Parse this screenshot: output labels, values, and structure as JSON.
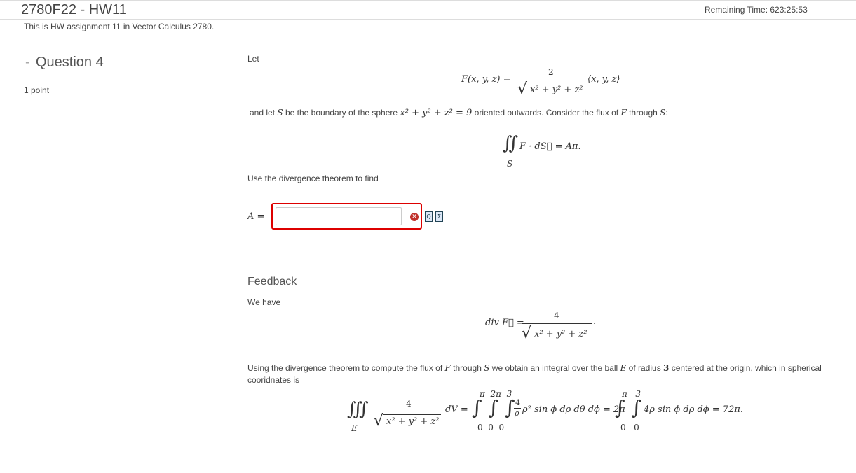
{
  "header": {
    "title": "2780F22 - HW11",
    "remaining_time": "Remaining Time:  623:25:53",
    "description": "This is HW assignment 11 in Vector Calculus 2780."
  },
  "sidebar": {
    "toggle": "-",
    "question_title": "Question 4",
    "points": "1 point"
  },
  "question": {
    "let": "Let",
    "field_lhs": "F(x, y, z) =",
    "field_numerator": "2",
    "field_radicand": "x² + y² + z²",
    "field_vector": "⟨x, y, z⟩",
    "sentence_pre": "and let ",
    "sentence_S": "S",
    "sentence_mid": " be the boundary of the sphere ",
    "sentence_eq": "x² + y² + z² = 9",
    "sentence_post": " oriented outwards. Consider the flux of ",
    "sentence_F": "F",
    "sentence_through": " through ",
    "sentence_S2": "S",
    "sentence_colon": ":",
    "flux_integral": "∬",
    "flux_body": "F · dS⃗ = Aπ.",
    "flux_sub": "S",
    "instruction": "Use the divergence theorem to find",
    "answer_label": "A =",
    "answer_value": "",
    "error_icon": "✕",
    "preview_icon": "Q",
    "equation_icon": "Σ"
  },
  "feedback": {
    "title": "Feedback",
    "we_have": "We have",
    "div_lhs": "div F⃗ =",
    "div_numerator": "4",
    "div_radicand": "x² + y² + z²",
    "div_period": ".",
    "using_pre": "Using the divergence theorem to compute the flux of ",
    "using_F": "F",
    "using_mid": " through ",
    "using_S": "S",
    "using_mid2": " we obtain an integral over the ball ",
    "using_E": "E",
    "using_mid3": " of radius ",
    "using_3": "3",
    "using_post": " centered at the origin, which in spherical",
    "using_line2": "cooridnates is",
    "triple": "∭",
    "triple_sub": "E",
    "t_numerator": "4",
    "t_radicand": "x² + y² + z²",
    "dV": "dV =",
    "iter_limits_top": "π  2π  3",
    "iter_integrals": "∫ ∫ ∫",
    "iter_limits_bottom": "0  0  0",
    "rho_num": "4",
    "rho_den": "ρ",
    "body1": "ρ² sin ϕ dρ dθ dϕ = 2π",
    "iter2_top": "π   3",
    "iter2_integrals": "∫ ∫",
    "iter2_bottom": "0   0",
    "body2": "4ρ sin ϕ dρ dϕ = 72π."
  }
}
